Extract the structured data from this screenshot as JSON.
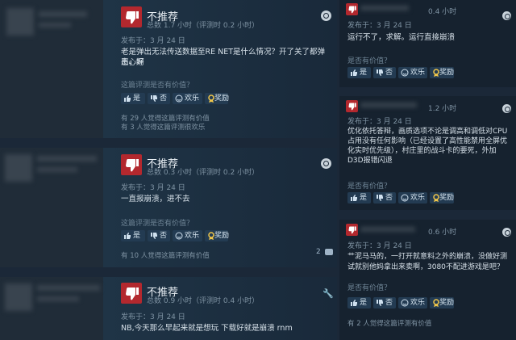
{
  "reviews": {
    "r1": {
      "verdict": "不推荐",
      "hours": "总数 1.7 小时（评测时 0.2 小时）",
      "posted": "发布于：3 月 24 日",
      "text1": "老是弹出无法传送数据至RE NET是什么情况？开了关了都弹出，好",
      "text2": "恶心啊",
      "question": "这篇评测是否有价值？",
      "yes": "是",
      "no": "否",
      "funny": "欢乐",
      "award": "奖励",
      "stat1": "有 29 人觉得这篇评测有价值",
      "stat2": "有 3 人觉得这篇评测很欢乐"
    },
    "r2": {
      "verdict": "不推荐",
      "hours": "总数 0.3 小时（评测时 0.2 小时）",
      "posted": "发布于：3 月 24 日",
      "text1": "一直报崩溃，进不去",
      "question": "这篇评测是否有价值？",
      "yes": "是",
      "no": "否",
      "funny": "欢乐",
      "award": "奖励",
      "stat1": "有 10 人觉得这篇评测有价值",
      "comments": "2"
    },
    "r3": {
      "verdict": "不推荐",
      "hours": "总数 0.9 小时（评测时 0.4 小时）",
      "posted": "发布于：3 月 24 日",
      "text1": "NB,今天那么早起来就是想玩 下载好就是崩溃 rnm"
    },
    "r4": {
      "hours": "0.4 小时",
      "posted": "发布于：3 月 24 日",
      "text1": "运行不了，求解。运行直接崩溃",
      "question": "是否有价值？",
      "yes": "是",
      "no": "否",
      "funny": "欢乐",
      "award": "奖励"
    },
    "r5": {
      "hours": "1.2 小时",
      "posted": "发布于：3 月 24 日",
      "text1": "优化依托答辩，画质选项不论是调高和调低对CPU",
      "text2": "占用没有任何影响（已经设置了高性能禁用全屏优",
      "text3": "化实时优先级），村庄里的战斗卡的要死，外加",
      "text4": "D3D报错闪退",
      "question": "是否有价值？",
      "yes": "是",
      "no": "否",
      "funny": "欢乐",
      "award": "奖励"
    },
    "r6": {
      "hours": "0.6 小时",
      "posted": "发布于：3 月 24 日",
      "text1": "艹泥马马的，一打开就意料之外的崩溃，没做好测",
      "text2": "试就别他妈拿出来卖啊，3080不配进游戏是吧？",
      "question": "是否有价值？",
      "yes": "是",
      "no": "否",
      "funny": "欢乐",
      "award": "奖励",
      "stat1": "有 2 人觉得这篇评测有价值"
    }
  },
  "colors": {
    "thumb_bg": "#b3282e",
    "button_bg": "#233b52",
    "page_bg": "#1b2838"
  }
}
